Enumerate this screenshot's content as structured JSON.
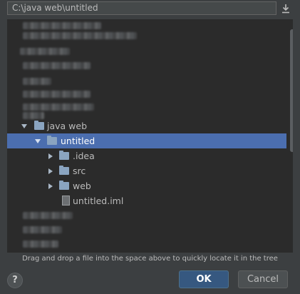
{
  "path_field": {
    "value": "C:\\java web\\untitled"
  },
  "icons": {
    "download": "download-arrow-icon",
    "help": "help-icon",
    "folder": "folder-icon",
    "file": "module-file-icon"
  },
  "tree": {
    "nodes": [
      {
        "label": "java web",
        "expanded": true,
        "selected": false
      },
      {
        "label": "untitled",
        "expanded": true,
        "selected": true
      },
      {
        "label": ".idea",
        "expanded": false,
        "selected": false
      },
      {
        "label": "src",
        "expanded": false,
        "selected": false
      },
      {
        "label": "web",
        "expanded": false,
        "selected": false
      },
      {
        "label": "untitled.iml",
        "selected": false
      }
    ]
  },
  "hint": "Drag and drop a file into the space above to quickly locate it in the tree",
  "buttons": {
    "help": "?",
    "ok": "OK",
    "cancel": "Cancel"
  },
  "colors": {
    "selection": "#4b6eaf",
    "tree_bg": "#2b2b2b",
    "dialog_bg": "#3c3f41",
    "ok_bg": "#365880"
  }
}
